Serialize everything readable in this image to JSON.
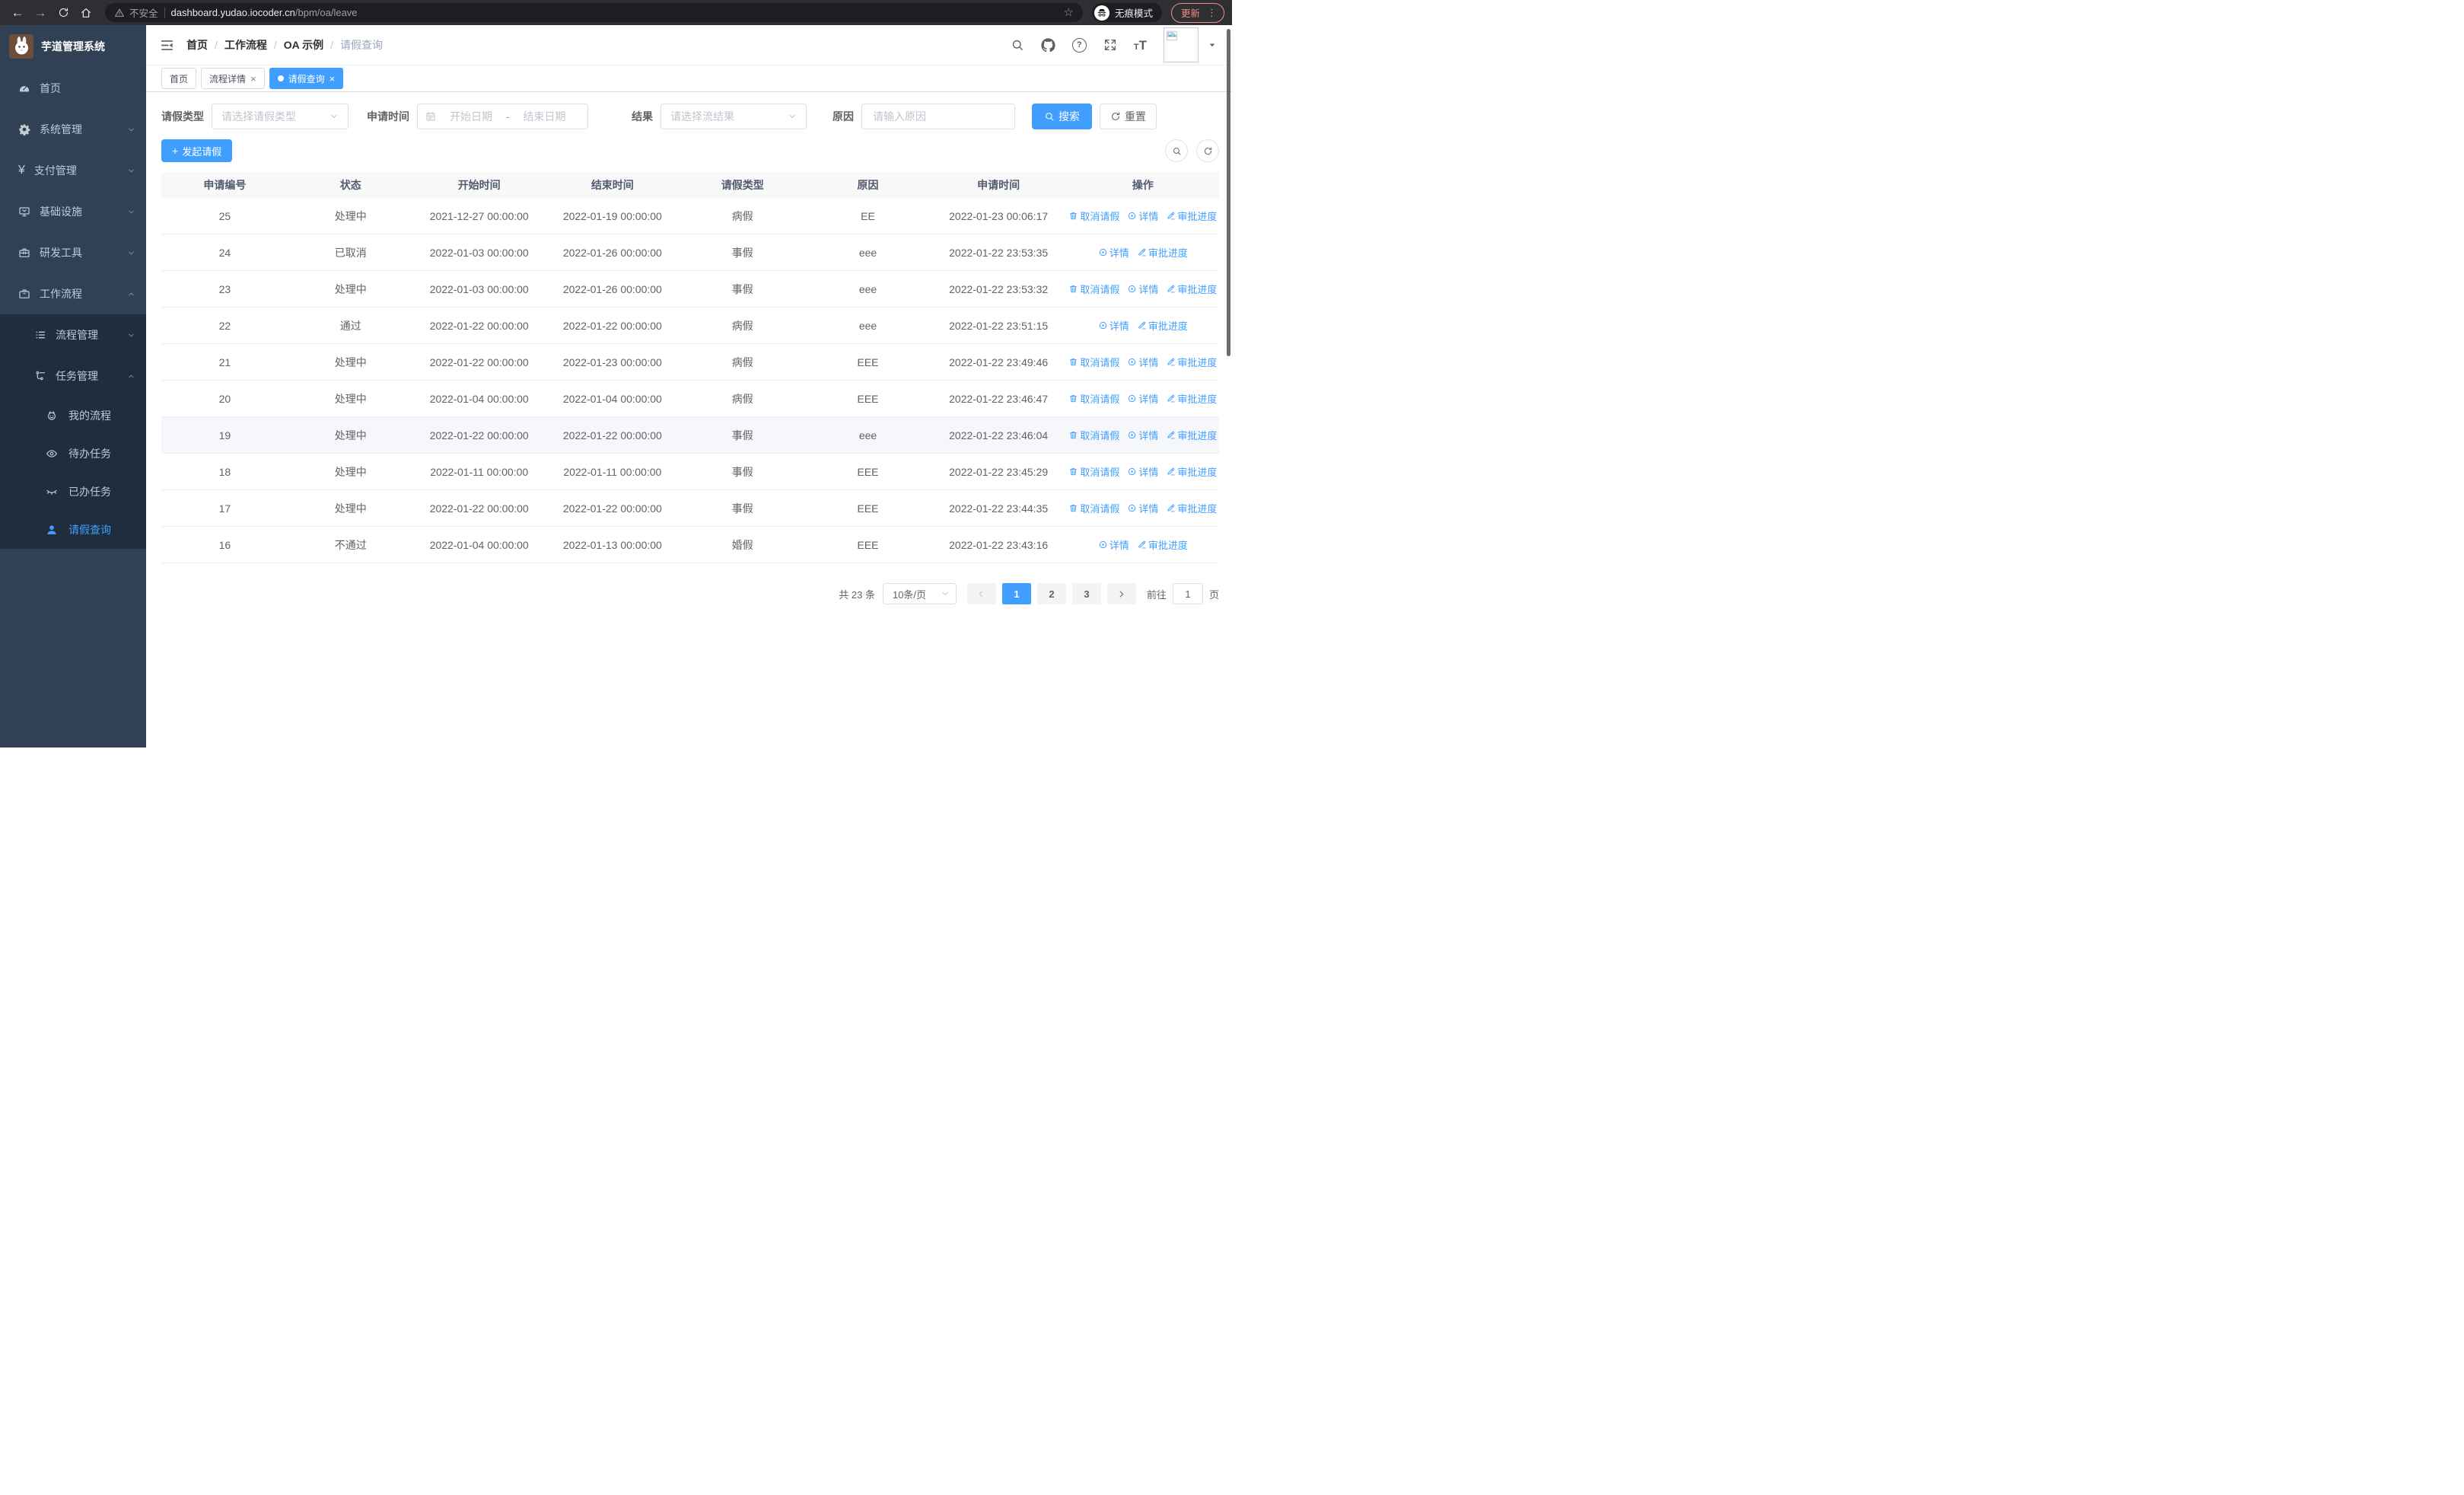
{
  "colors": {
    "primary": "#409eff",
    "sidebar_bg": "#304156",
    "submenu_bg": "#1f2d3d",
    "update_accent": "#f28b82"
  },
  "browser": {
    "security_label": "不安全",
    "url_host": "dashboard.yudao.iocoder.cn",
    "url_path": "/bpm/oa/leave",
    "incognito_label": "无痕模式",
    "update_label": "更新"
  },
  "sidebar": {
    "brand": "芋道管理系统",
    "items": [
      {
        "label": "首页",
        "icon": "gauge-icon",
        "level": 1,
        "chevron": null,
        "submenu": false,
        "active": false
      },
      {
        "label": "系统管理",
        "icon": "gear-icon",
        "level": 1,
        "chevron": "down",
        "submenu": false,
        "active": false
      },
      {
        "label": "支付管理",
        "icon": "yen-icon",
        "level": 1,
        "chevron": "down",
        "submenu": false,
        "active": false
      },
      {
        "label": "基础设施",
        "icon": "monitor-icon",
        "level": 1,
        "chevron": "down",
        "submenu": false,
        "active": false
      },
      {
        "label": "研发工具",
        "icon": "toolbox-icon",
        "level": 1,
        "chevron": "down",
        "submenu": false,
        "active": false
      },
      {
        "label": "工作流程",
        "icon": "briefcase-icon",
        "level": 1,
        "chevron": "up",
        "submenu": false,
        "active": false
      },
      {
        "label": "流程管理",
        "icon": "list-icon",
        "level": 2,
        "chevron": "down",
        "submenu": true,
        "active": false
      },
      {
        "label": "任务管理",
        "icon": "tree-icon",
        "level": 2,
        "chevron": "up",
        "submenu": true,
        "active": false
      },
      {
        "label": "我的流程",
        "icon": "robot-icon",
        "level": 3,
        "chevron": null,
        "submenu": true,
        "active": false
      },
      {
        "label": "待办任务",
        "icon": "eye-icon",
        "level": 3,
        "chevron": null,
        "submenu": true,
        "active": false
      },
      {
        "label": "已办任务",
        "icon": "eye-closed-icon",
        "level": 3,
        "chevron": null,
        "submenu": true,
        "active": false
      },
      {
        "label": "请假查询",
        "icon": "user-icon",
        "level": 3,
        "chevron": null,
        "submenu": true,
        "active": true
      }
    ]
  },
  "header": {
    "breadcrumbs": [
      "首页",
      "工作流程",
      "OA 示例",
      "请假查询"
    ]
  },
  "tabs": [
    {
      "label": "首页",
      "closable": false,
      "active": false
    },
    {
      "label": "流程详情",
      "closable": true,
      "active": false
    },
    {
      "label": "请假查询",
      "closable": true,
      "active": true
    }
  ],
  "filters": {
    "type_label": "请假类型",
    "type_placeholder": "请选择请假类型",
    "time_label": "申请时间",
    "start_placeholder": "开始日期",
    "range_separator": "-",
    "end_placeholder": "结束日期",
    "result_label": "结果",
    "result_placeholder": "请选择流结果",
    "reason_label": "原因",
    "reason_placeholder": "请输入原因",
    "search_label": "搜索",
    "reset_label": "重置"
  },
  "toolbar": {
    "create_label": "发起请假"
  },
  "table": {
    "columns": [
      "申请编号",
      "状态",
      "开始时间",
      "结束时间",
      "请假类型",
      "原因",
      "申请时间",
      "操作"
    ],
    "actions": {
      "cancel": "取消请假",
      "detail": "详情",
      "progress": "审批进度"
    },
    "rows": [
      {
        "id": "25",
        "status": "处理中",
        "start": "2021-12-27 00:00:00",
        "end": "2022-01-19 00:00:00",
        "type": "病假",
        "reason": "EE",
        "applied": "2022-01-23 00:06:17",
        "actions": [
          "cancel",
          "detail",
          "progress"
        ],
        "highlighted": false
      },
      {
        "id": "24",
        "status": "已取消",
        "start": "2022-01-03 00:00:00",
        "end": "2022-01-26 00:00:00",
        "type": "事假",
        "reason": "eee",
        "applied": "2022-01-22 23:53:35",
        "actions": [
          "detail",
          "progress"
        ],
        "highlighted": false
      },
      {
        "id": "23",
        "status": "处理中",
        "start": "2022-01-03 00:00:00",
        "end": "2022-01-26 00:00:00",
        "type": "事假",
        "reason": "eee",
        "applied": "2022-01-22 23:53:32",
        "actions": [
          "cancel",
          "detail",
          "progress"
        ],
        "highlighted": false
      },
      {
        "id": "22",
        "status": "通过",
        "start": "2022-01-22 00:00:00",
        "end": "2022-01-22 00:00:00",
        "type": "病假",
        "reason": "eee",
        "applied": "2022-01-22 23:51:15",
        "actions": [
          "detail",
          "progress"
        ],
        "highlighted": false
      },
      {
        "id": "21",
        "status": "处理中",
        "start": "2022-01-22 00:00:00",
        "end": "2022-01-23 00:00:00",
        "type": "病假",
        "reason": "EEE",
        "applied": "2022-01-22 23:49:46",
        "actions": [
          "cancel",
          "detail",
          "progress"
        ],
        "highlighted": false
      },
      {
        "id": "20",
        "status": "处理中",
        "start": "2022-01-04 00:00:00",
        "end": "2022-01-04 00:00:00",
        "type": "病假",
        "reason": "EEE",
        "applied": "2022-01-22 23:46:47",
        "actions": [
          "cancel",
          "detail",
          "progress"
        ],
        "highlighted": false
      },
      {
        "id": "19",
        "status": "处理中",
        "start": "2022-01-22 00:00:00",
        "end": "2022-01-22 00:00:00",
        "type": "事假",
        "reason": "eee",
        "applied": "2022-01-22 23:46:04",
        "actions": [
          "cancel",
          "detail",
          "progress"
        ],
        "highlighted": true
      },
      {
        "id": "18",
        "status": "处理中",
        "start": "2022-01-11 00:00:00",
        "end": "2022-01-11 00:00:00",
        "type": "事假",
        "reason": "EEE",
        "applied": "2022-01-22 23:45:29",
        "actions": [
          "cancel",
          "detail",
          "progress"
        ],
        "highlighted": false
      },
      {
        "id": "17",
        "status": "处理中",
        "start": "2022-01-22 00:00:00",
        "end": "2022-01-22 00:00:00",
        "type": "事假",
        "reason": "EEE",
        "applied": "2022-01-22 23:44:35",
        "actions": [
          "cancel",
          "detail",
          "progress"
        ],
        "highlighted": false
      },
      {
        "id": "16",
        "status": "不通过",
        "start": "2022-01-04 00:00:00",
        "end": "2022-01-13 00:00:00",
        "type": "婚假",
        "reason": "EEE",
        "applied": "2022-01-22 23:43:16",
        "actions": [
          "detail",
          "progress"
        ],
        "highlighted": false
      }
    ]
  },
  "pagination": {
    "total_label": "共 23 条",
    "page_size": "10条/页",
    "pages": [
      "1",
      "2",
      "3"
    ],
    "active_page": "1",
    "goto_label": "前往",
    "goto_value": "1",
    "goto_suffix": "页"
  }
}
